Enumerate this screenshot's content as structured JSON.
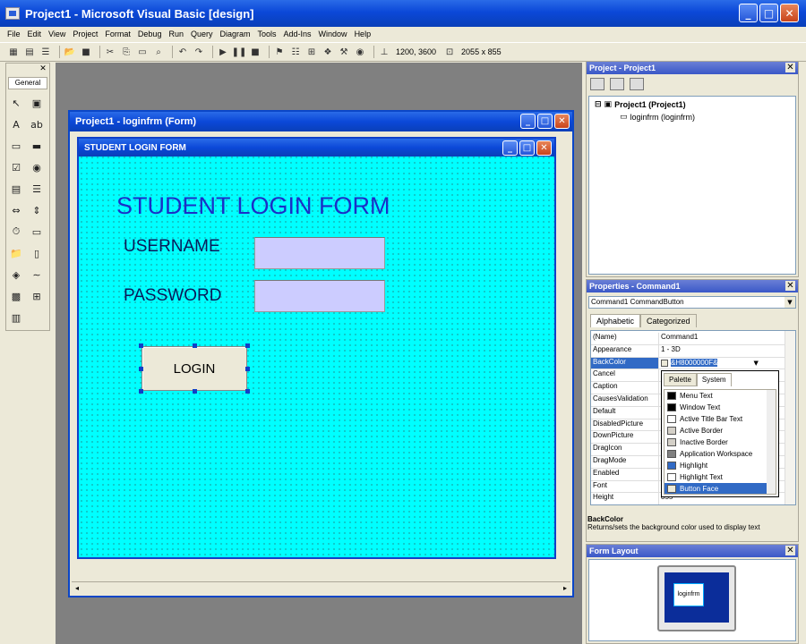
{
  "app": {
    "title": "Project1 - Microsoft Visual Basic [design]"
  },
  "window_controls": {
    "minimize": "_",
    "maximize": "□",
    "close": "✕"
  },
  "menu": [
    "File",
    "Edit",
    "View",
    "Project",
    "Format",
    "Debug",
    "Run",
    "Query",
    "Diagram",
    "Tools",
    "Add-Ins",
    "Window",
    "Help"
  ],
  "toolbar": {
    "position": "1200, 3600",
    "size": "2055 x 855"
  },
  "toolbox": {
    "tab": "General",
    "close": "✕"
  },
  "form_window": {
    "title": "Project1 - loginfrm (Form)"
  },
  "design_form": {
    "caption": "STUDENT LOGIN FORM",
    "heading": "STUDENT LOGIN FORM",
    "username_label": "USERNAME",
    "password_label": "PASSWORD",
    "login_button": "LOGIN",
    "username_color": "#ccccff",
    "back_color": "#00ffff"
  },
  "project_panel": {
    "title": "Project - Project1",
    "tree": [
      {
        "label": "Project1 (Project1)",
        "bold": true
      },
      {
        "label": "loginfrm (loginfrm)",
        "bold": false
      }
    ]
  },
  "properties_panel": {
    "title": "Properties - Command1",
    "object": "Command1  CommandButton",
    "tabs": [
      "Alphabetic",
      "Categorized"
    ],
    "rows": [
      {
        "name": "(Name)",
        "value": "Command1"
      },
      {
        "name": "Appearance",
        "value": "1 - 3D"
      },
      {
        "name": "BackColor",
        "value": "&H8000000F&",
        "selected": true
      },
      {
        "name": "Cancel",
        "value": ""
      },
      {
        "name": "Caption",
        "value": ""
      },
      {
        "name": "CausesValidation",
        "value": ""
      },
      {
        "name": "Default",
        "value": ""
      },
      {
        "name": "DisabledPicture",
        "value": ""
      },
      {
        "name": "DownPicture",
        "value": ""
      },
      {
        "name": "DragIcon",
        "value": ""
      },
      {
        "name": "DragMode",
        "value": ""
      },
      {
        "name": "Enabled",
        "value": ""
      },
      {
        "name": "Font",
        "value": ""
      },
      {
        "name": "Height",
        "value": "855"
      }
    ],
    "color_popup": {
      "tabs": [
        "Palette",
        "System"
      ],
      "items": [
        {
          "label": "Menu Text",
          "color": "#000000"
        },
        {
          "label": "Window Text",
          "color": "#000000"
        },
        {
          "label": "Active Title Bar Text",
          "color": "#ffffff"
        },
        {
          "label": "Active Border",
          "color": "#d4d0c8"
        },
        {
          "label": "Inactive Border",
          "color": "#d4d0c8"
        },
        {
          "label": "Application Workspace",
          "color": "#808080"
        },
        {
          "label": "Highlight",
          "color": "#316ac5"
        },
        {
          "label": "Highlight Text",
          "color": "#ffffff"
        },
        {
          "label": "Button Face",
          "color": "#ece9d8",
          "selected": true
        }
      ]
    },
    "description_title": "BackColor",
    "description": "Returns/sets the background color used to display text"
  },
  "form_layout": {
    "title": "Form Layout",
    "mini_label": "loginfrm"
  }
}
